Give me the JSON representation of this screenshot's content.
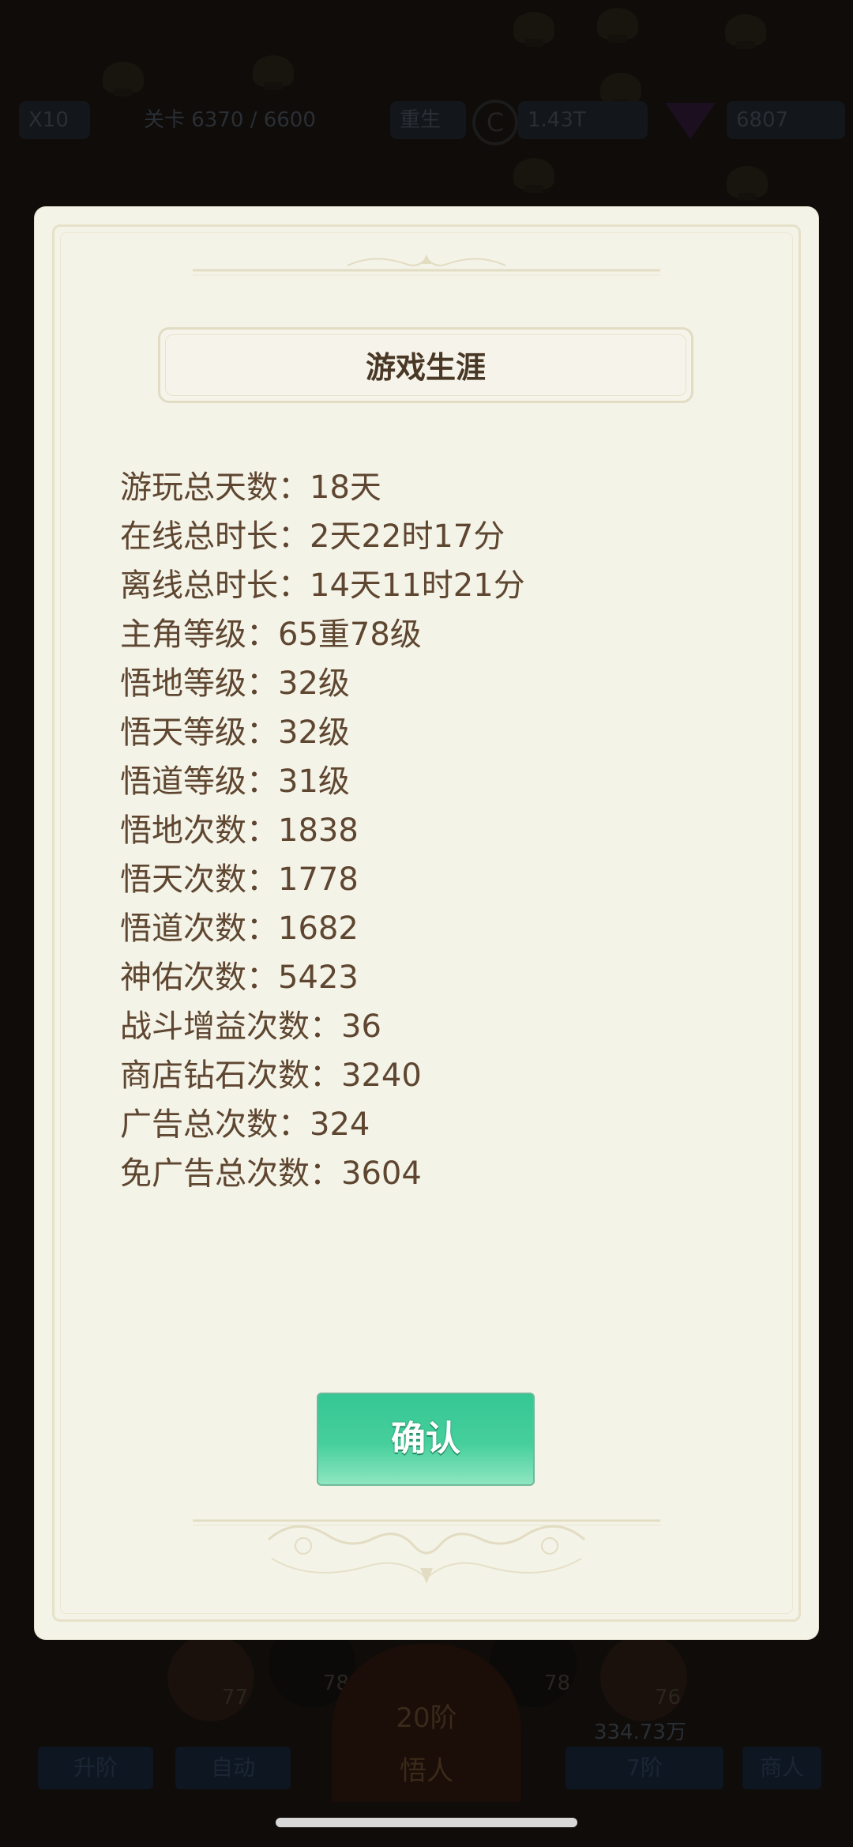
{
  "background": {
    "top_bar": {
      "speed_label": "X10",
      "stage_label": "关卡 6370 / 6600",
      "rebirth_label": "重生",
      "coin_value": "1.43T",
      "gem_value": "6807"
    },
    "bottom_bar": {
      "upgrade_label": "升阶",
      "auto_label": "自动",
      "main_level": "20阶",
      "main_action": "悟人",
      "power_value": "334.73万",
      "level_value": "7阶",
      "shop_label": "商人",
      "circle_values": [
        "77",
        "78",
        "78",
        "76"
      ]
    }
  },
  "modal": {
    "title": "游戏生涯",
    "stats": [
      {
        "label": "游玩总天数：",
        "value": "18天"
      },
      {
        "label": "在线总时长：",
        "value": "2天22时17分"
      },
      {
        "label": "离线总时长：",
        "value": "14天11时21分"
      },
      {
        "label": "主角等级：",
        "value": "65重78级"
      },
      {
        "label": "悟地等级：",
        "value": "32级"
      },
      {
        "label": "悟天等级：",
        "value": "32级"
      },
      {
        "label": "悟道等级：",
        "value": "31级"
      },
      {
        "label": "悟地次数：",
        "value": "1838"
      },
      {
        "label": "悟天次数：",
        "value": "1778"
      },
      {
        "label": "悟道次数：",
        "value": "1682"
      },
      {
        "label": "神佑次数：",
        "value": "5423"
      },
      {
        "label": "战斗增益次数：",
        "value": "36"
      },
      {
        "label": "商店钻石次数：",
        "value": "3240"
      },
      {
        "label": "广告总次数：",
        "value": "324"
      },
      {
        "label": "免广告总次数：",
        "value": "3604"
      }
    ],
    "confirm_label": "确认"
  },
  "colors": {
    "modal_bg": "#f4f3e8",
    "text": "#5e4630",
    "title": "#4a3826",
    "confirm_button": "#46cf9c"
  }
}
